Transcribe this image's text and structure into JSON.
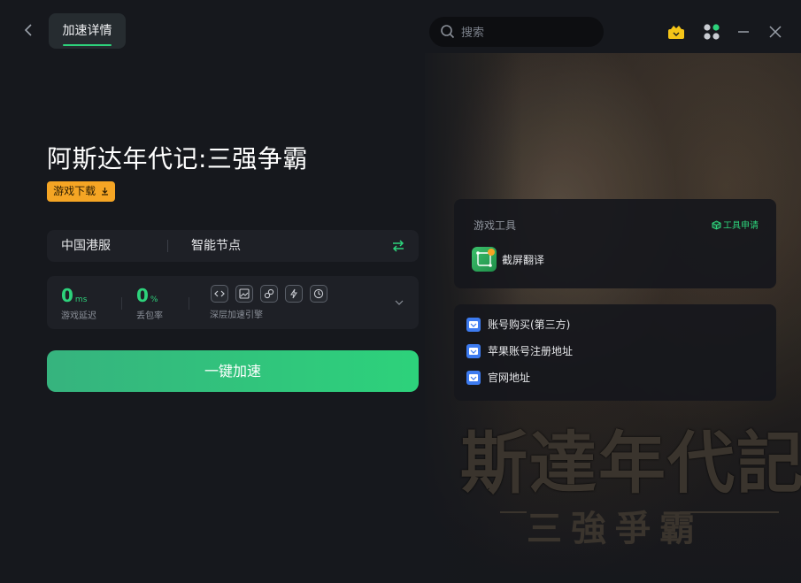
{
  "header": {
    "active_tab": "加速详情",
    "search_placeholder": "搜索"
  },
  "game": {
    "title": "阿斯达年代记:三强争霸",
    "download_label": "游戏下载",
    "banner_title": "斯達年代記",
    "banner_subtitle": "三強爭霸"
  },
  "server": {
    "region": "中国港服",
    "node": "智能节点"
  },
  "stats": {
    "latency_value": "0",
    "latency_unit": "ms",
    "latency_label": "游戏延迟",
    "loss_value": "0",
    "loss_unit": "%",
    "loss_label": "丢包率",
    "engine_label": "深层加速引擎"
  },
  "accelerate_label": "一键加速",
  "tools": {
    "title": "游戏工具",
    "apply_label": "工具申请",
    "items": [
      {
        "label": "截屏翻译"
      }
    ]
  },
  "links": [
    {
      "label": "账号购买(第三方)"
    },
    {
      "label": "苹果账号注册地址"
    },
    {
      "label": "官网地址"
    }
  ],
  "colors": {
    "accent": "#2dd27b",
    "download_button": "#f5a524",
    "link_icon": "#3d7bf0"
  }
}
